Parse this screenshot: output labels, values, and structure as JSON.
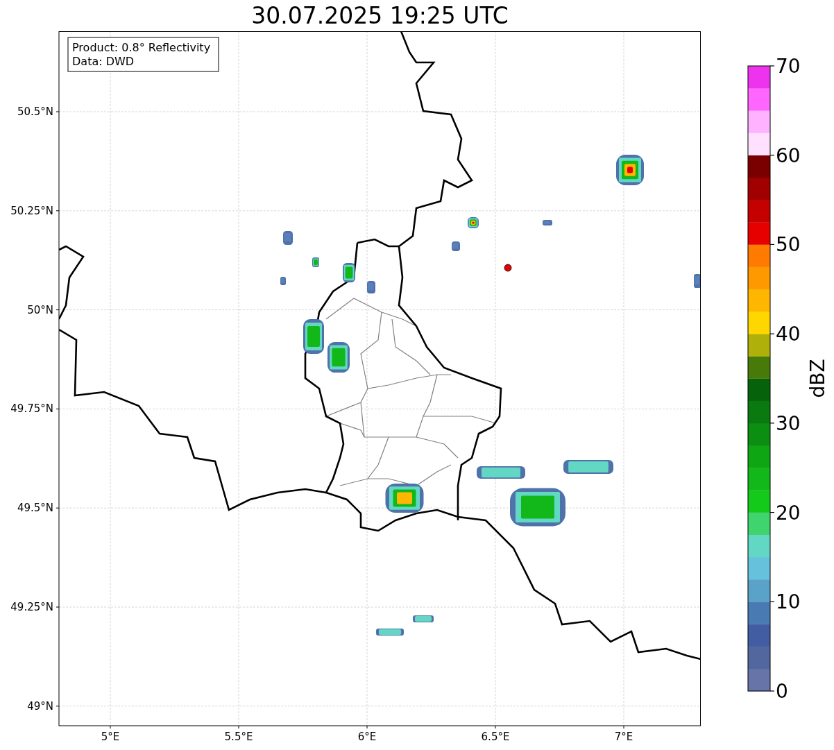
{
  "title": "30.07.2025 19:25 UTC",
  "legend": [
    "Product: 0.8° Reflectivity",
    "Data: DWD"
  ],
  "x_ticks": [
    "5°E",
    "5.5°E",
    "6°E",
    "6.5°E",
    "7°E"
  ],
  "y_ticks": [
    "50.5°N",
    "50.25°N",
    "50°N",
    "49.75°N",
    "49.5°N",
    "49.25°N",
    "49°N"
  ],
  "colorbar": {
    "label": "dBZ",
    "ticks": [
      "70",
      "60",
      "50",
      "40",
      "30",
      "20",
      "10",
      "0"
    ],
    "levels": [
      {
        "color": "#6674a8"
      },
      {
        "color": "#53679f"
      },
      {
        "color": "#425da1"
      },
      {
        "color": "#4a7ab2"
      },
      {
        "color": "#5ba2c8"
      },
      {
        "color": "#66c2dc"
      },
      {
        "color": "#62d8c4"
      },
      {
        "color": "#3fd46e"
      },
      {
        "color": "#13c91a"
      },
      {
        "color": "#12b81a"
      },
      {
        "color": "#0fa614"
      },
      {
        "color": "#0c8e12"
      },
      {
        "color": "#0a7a10"
      },
      {
        "color": "#07620c"
      },
      {
        "color": "#487a0a"
      },
      {
        "color": "#b0b00a"
      },
      {
        "color": "#ffd700"
      },
      {
        "color": "#ffb600"
      },
      {
        "color": "#ff9900"
      },
      {
        "color": "#ff7a00"
      },
      {
        "color": "#e60000"
      },
      {
        "color": "#c40000"
      },
      {
        "color": "#a00000"
      },
      {
        "color": "#7a0000"
      },
      {
        "color": "#ffe0ff"
      },
      {
        "color": "#ffb2ff"
      },
      {
        "color": "#ff66ff"
      },
      {
        "color": "#ee33ee"
      }
    ]
  }
}
